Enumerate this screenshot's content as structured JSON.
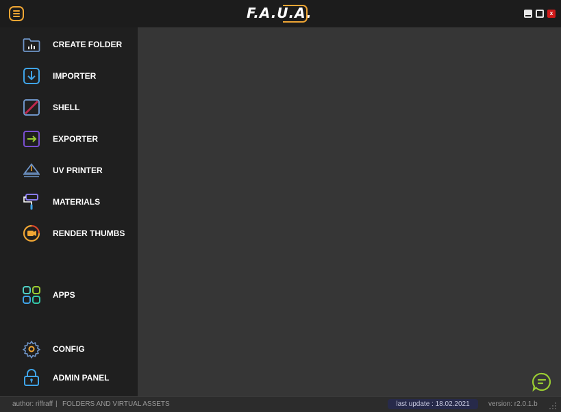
{
  "app": {
    "logo_text": "F.A.U.A.",
    "brand_color": "#f0a634"
  },
  "window_controls": {
    "minimize": "minimize-icon",
    "maximize": "maximize-icon",
    "close": "x"
  },
  "sidebar": {
    "items": [
      {
        "label": "CREATE FOLDER",
        "icon": "folder-chart-icon",
        "color": "#6f95c8"
      },
      {
        "label": "IMPORTER",
        "icon": "download-arrow-icon",
        "color": "#3fa4e8"
      },
      {
        "label": "SHELL",
        "icon": "shell-slash-icon",
        "color": "#c0284e"
      },
      {
        "label": "EXPORTER",
        "icon": "export-arrow-icon",
        "color": "#7a4fd1"
      },
      {
        "label": "UV PRINTER",
        "icon": "uv-printer-icon",
        "color": "#6f95c8"
      },
      {
        "label": "MATERIALS",
        "icon": "paint-roller-icon",
        "color": "#8a7cf0"
      },
      {
        "label": "RENDER THUMBS",
        "icon": "camera-ring-icon",
        "color": "#f0a634"
      },
      {
        "label": "APPS",
        "icon": "apps-grid-icon",
        "color": "#33c8a8"
      },
      {
        "label": "CONFIG",
        "icon": "gear-icon",
        "color": "#6f95c8"
      },
      {
        "label": "ADMIN PANEL",
        "icon": "lock-icon",
        "color": "#3fa4e8"
      }
    ]
  },
  "main": {
    "chat_icon": "chat-bubble-icon",
    "chat_color": "#9acd32"
  },
  "status": {
    "author": "author: riffraff",
    "separator": "|",
    "description": "FOLDERS AND VIRTUAL ASSETS",
    "last_update": "last update : 18.02.2021",
    "version": "version: r2.0.1.b"
  }
}
